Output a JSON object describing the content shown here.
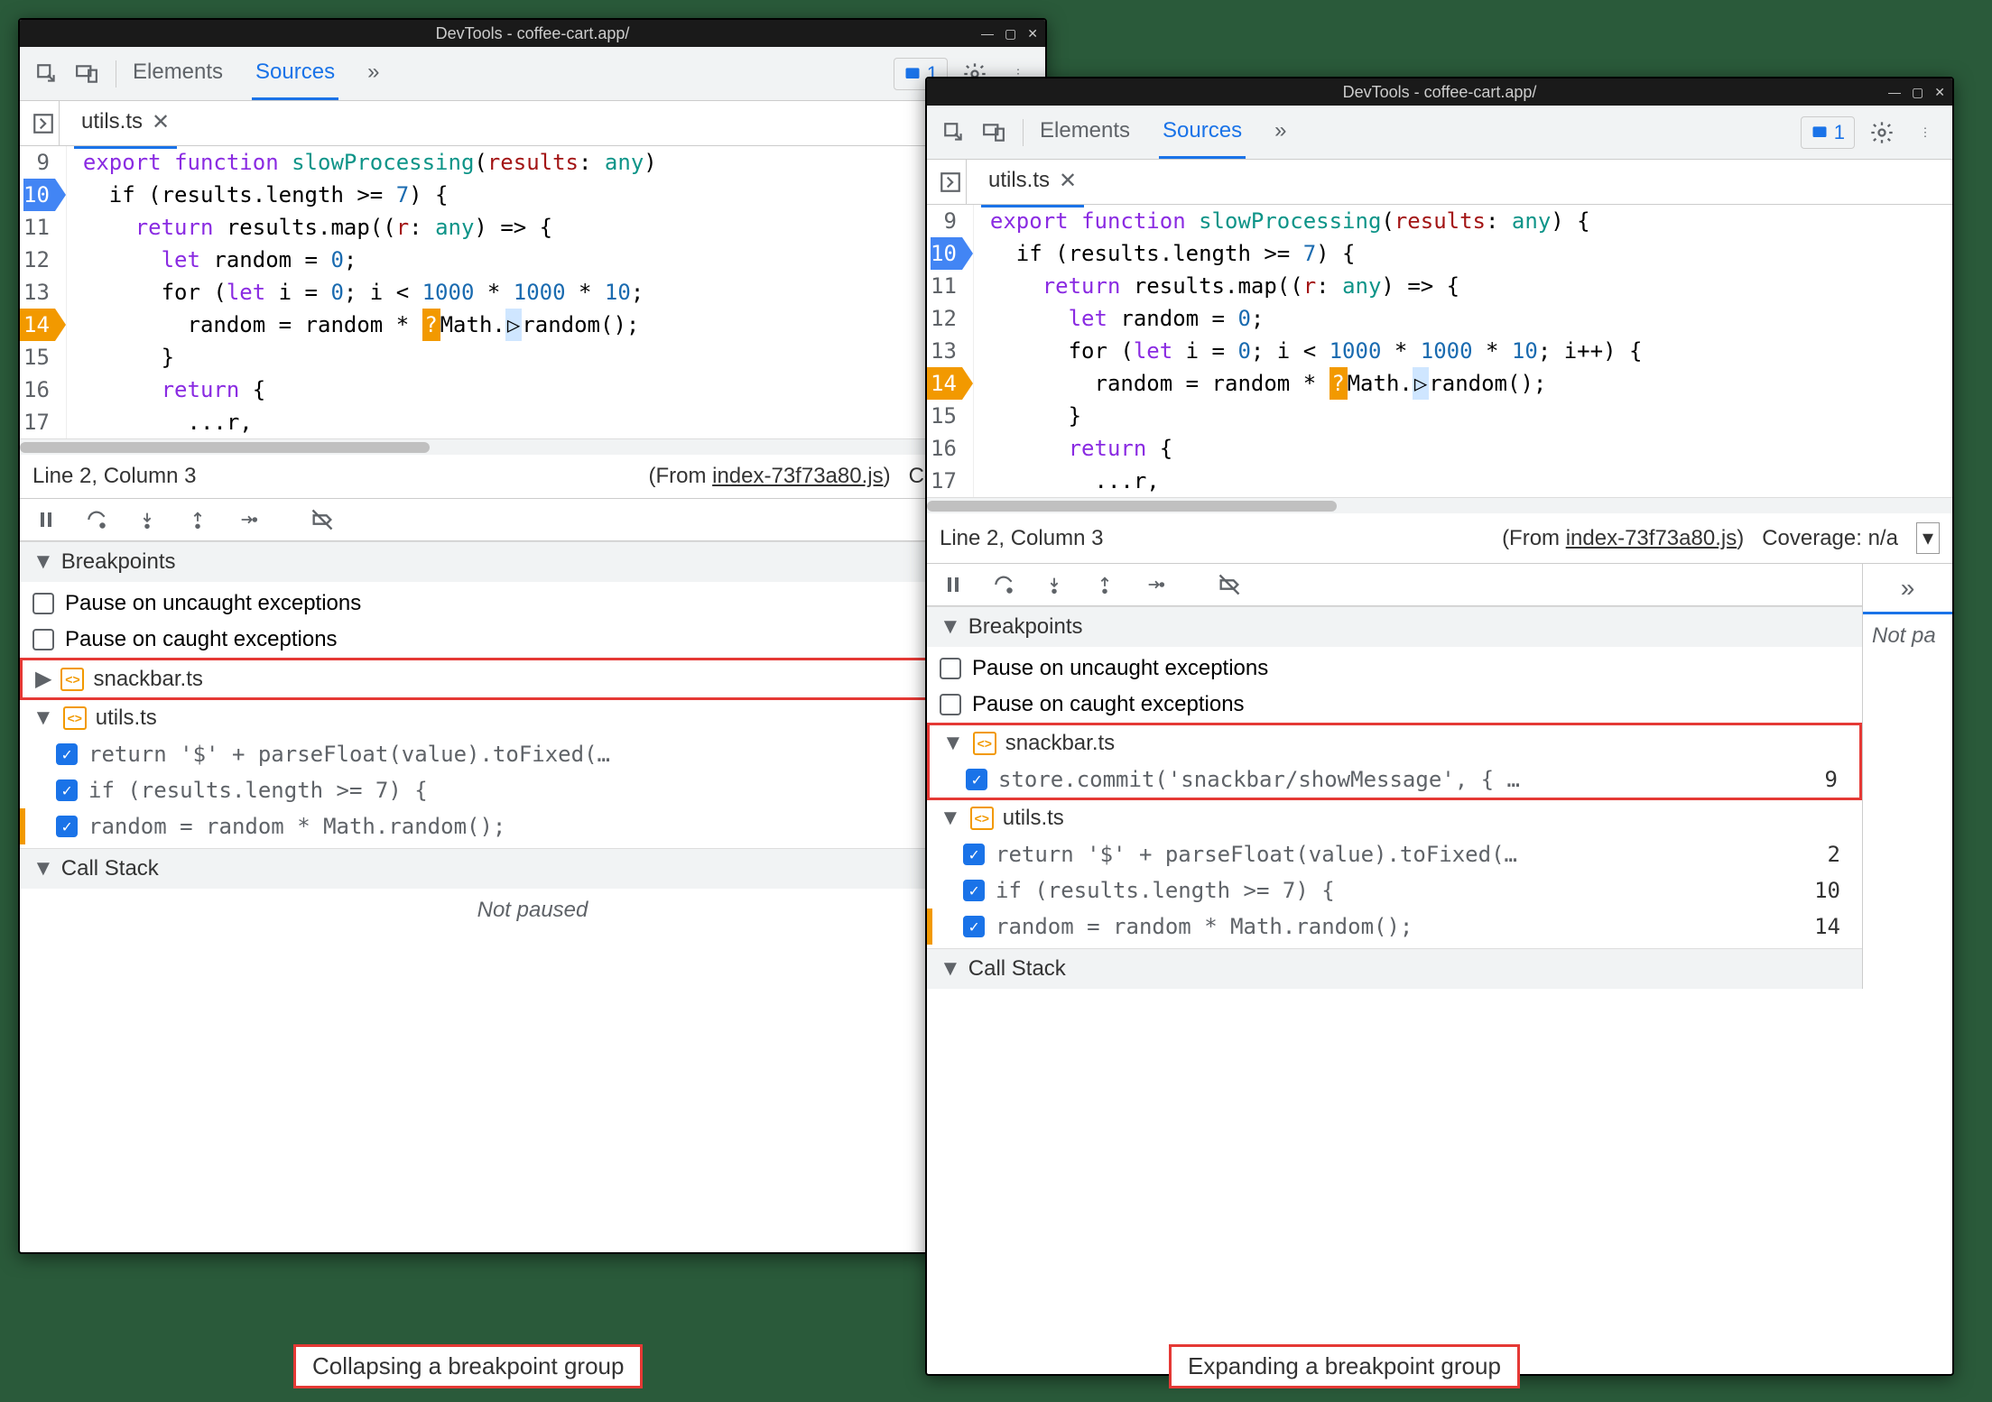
{
  "titlebar": "DevTools - coffee-cart.app/",
  "toolbar": {
    "tabs": {
      "elements": "Elements",
      "sources": "Sources"
    },
    "issue_count": "1"
  },
  "file_tab": {
    "name": "utils.ts"
  },
  "code": {
    "lines": [
      9,
      10,
      11,
      12,
      13,
      14,
      15,
      16,
      17
    ],
    "l9a": "export ",
    "l9b": "function ",
    "l9c": "slowProcessing",
    "l9d": "(",
    "l9e": "results",
    "l9f": ": ",
    "l9g": "any",
    "l9h": ")",
    "l9tail_left": "",
    "l9tail_right": " {",
    "l10": "  if (results.length >= ",
    "l10n": "7",
    "l10b": ") {",
    "l11a": "    return ",
    "l11b": "results.map((",
    "l11c": "r",
    "l11d": ": ",
    "l11e": "any",
    "l11f": ") => {",
    "l12a": "      let ",
    "l12b": "random = ",
    "l12n": "0",
    "l12c": ";",
    "l13a": "      for (",
    "l13b": "let ",
    "l13c": "i = ",
    "l13n1": "0",
    "l13d": "; i < ",
    "l13n2": "1000",
    "l13e": " * ",
    "l13n3": "1000",
    "l13f": " * ",
    "l13n4": "10",
    "l13g_left": ";",
    "l13g_right": "; i++) {",
    "l14a": "        random = random * ",
    "l14b": "Math.",
    "l14c": "random",
    "l14d": "();",
    "l15": "      }",
    "l16a": "      return ",
    "l16b": "{",
    "l17": "        ...r,"
  },
  "statusbar": {
    "pos": "Line 2, Column 3",
    "from_label": "(From ",
    "from_file": "index-73f73a80.js",
    "from_close": ")",
    "coverage_left": "Coverage: n/",
    "coverage_right": "Coverage: n/a"
  },
  "sections": {
    "breakpoints": "Breakpoints",
    "pause_uncaught": "Pause on uncaught exceptions",
    "pause_caught": "Pause on caught exceptions",
    "snackbar": "snackbar.ts",
    "utils": "utils.ts",
    "snackbar_line": "store.commit('snackbar/showMessage', { …",
    "snackbar_no": "9",
    "bp1": "return '$' + parseFloat(value).toFixed(…",
    "bp1n": "2",
    "bp2": "if (results.length >= 7) {",
    "bp2n": "10",
    "bp3": "random = random * Math.random();",
    "bp3n": "14",
    "callstack": "Call Stack",
    "not_paused": "Not paused",
    "not_paused_right": "Not pa"
  },
  "captions": {
    "left": "Collapsing a breakpoint group",
    "right": "Expanding a breakpoint group"
  }
}
